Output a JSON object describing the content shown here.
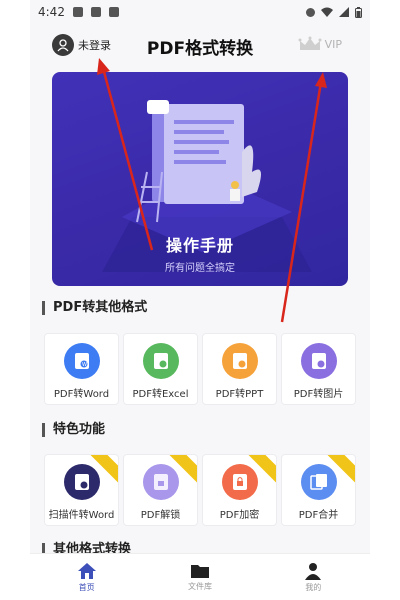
{
  "status_bar": {
    "time": "4:42"
  },
  "header": {
    "title": "PDF格式转换",
    "login_label": "未登录",
    "vip_label": "VIP"
  },
  "banner": {
    "title": "操作手册",
    "subtitle": "所有问题全搞定"
  },
  "sections": {
    "pdf_to_other": {
      "title": "PDF转其他格式",
      "items": [
        {
          "label": "PDF转Word",
          "icon": "word-doc-icon",
          "color": "#3d7cf2"
        },
        {
          "label": "PDF转Excel",
          "icon": "excel-doc-icon",
          "color": "#57b85d"
        },
        {
          "label": "PDF转PPT",
          "icon": "ppt-doc-icon",
          "color": "#f6a23b"
        },
        {
          "label": "PDF转图片",
          "icon": "image-doc-icon",
          "color": "#8a6fe0"
        }
      ]
    },
    "features": {
      "title": "特色功能",
      "items": [
        {
          "label": "扫描件转Word",
          "icon": "scan-icon",
          "color": "#2d2a6b"
        },
        {
          "label": "PDF解锁",
          "icon": "unlock-icon",
          "color": "#a897ea"
        },
        {
          "label": "PDF加密",
          "icon": "lock-icon",
          "color": "#f26b4a"
        },
        {
          "label": "PDF合并",
          "icon": "merge-icon",
          "color": "#5c8df0"
        }
      ]
    },
    "other": {
      "title": "其他格式转换"
    }
  },
  "bottom_nav": {
    "items": [
      {
        "label": "首页",
        "icon": "home-icon",
        "active": true
      },
      {
        "label": "文件库",
        "icon": "folder-icon",
        "active": false
      },
      {
        "label": "我的",
        "icon": "person-icon",
        "active": false
      }
    ]
  },
  "colors": {
    "accent": "#3d4fb8",
    "banner": "#3a2aa8",
    "arrow": "#d9261c",
    "ribbon": "#f0c419"
  }
}
